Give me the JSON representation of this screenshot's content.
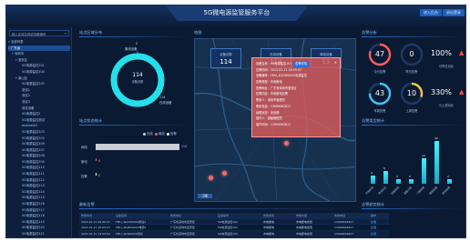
{
  "header": {
    "title": "5G微电源监管服务平台",
    "btn_left": "进入后台",
    "btn_right": "退出登录"
  },
  "sidebar": {
    "search_placeholder": "输入区域名称或设备编号",
    "items": [
      {
        "label": "全部列表",
        "level": 0,
        "caret": "▾"
      },
      {
        "label": "广东省",
        "level": 0,
        "caret": "▾",
        "selected": true
      },
      {
        "label": "深圳市",
        "level": 1,
        "caret": "▾"
      },
      {
        "label": "宝安区",
        "level": 2,
        "caret": "▾"
      },
      {
        "label": "5G电源监控101",
        "level": 3,
        "caret": ""
      },
      {
        "label": "5G电源监控104",
        "level": 3,
        "caret": ""
      },
      {
        "label": "南山区",
        "level": 2,
        "caret": "▾"
      },
      {
        "label": "5G电源监控102",
        "level": 3,
        "caret": ""
      },
      {
        "label": "测试1",
        "level": 3,
        "caret": ""
      },
      {
        "label": "测试2",
        "level": 3,
        "caret": ""
      },
      {
        "label": "测试3",
        "level": 3,
        "caret": ""
      },
      {
        "label": "测试设备",
        "level": 3,
        "caret": ""
      },
      {
        "label": "5G电源监控1",
        "level": 3,
        "caret": ""
      },
      {
        "label": "5G电源监控测试",
        "level": 3,
        "caret": ""
      },
      {
        "label": "meltest01",
        "level": 3,
        "caret": ""
      },
      {
        "label": "5G电源监控103",
        "level": 3,
        "caret": ""
      },
      {
        "label": "5G电源监控105",
        "level": 3,
        "caret": ""
      },
      {
        "label": "5G电源监控106",
        "level": 3,
        "caret": ""
      },
      {
        "label": "5G电源监控107",
        "level": 3,
        "caret": ""
      },
      {
        "label": "5G电源监控108",
        "level": 3,
        "caret": ""
      },
      {
        "label": "5G电源监控109",
        "level": 3,
        "caret": ""
      },
      {
        "label": "5G电源监控110",
        "level": 3,
        "caret": ""
      },
      {
        "label": "5G电源监控111",
        "level": 3,
        "caret": ""
      },
      {
        "label": "5G电源监控112",
        "level": 3,
        "caret": ""
      },
      {
        "label": "5G电源监控113",
        "level": 3,
        "caret": ""
      },
      {
        "label": "5G电源监控114",
        "level": 3,
        "caret": ""
      },
      {
        "label": "5G电源监控115",
        "level": 3,
        "caret": ""
      },
      {
        "label": "5G电源监控116",
        "level": 3,
        "caret": ""
      },
      {
        "label": "5G电源监控117",
        "level": 3,
        "caret": ""
      },
      {
        "label": "5G电源监控118",
        "level": 3,
        "caret": ""
      },
      {
        "label": "5G电源监控119",
        "level": 3,
        "caret": ""
      },
      {
        "label": "5G电源监控120",
        "level": 3,
        "caret": ""
      },
      {
        "label": "5G电源监控121",
        "level": 3,
        "caret": ""
      },
      {
        "label": "5G电源监控122",
        "level": 3,
        "caret": ""
      }
    ]
  },
  "device_distribution": {
    "title": "站点区域分布",
    "top_label": "离线设备",
    "top_value": "0",
    "center_value": "114",
    "center_label": "设备总数",
    "bottom_value": "114",
    "bottom_label": "在线设备"
  },
  "status_stats": {
    "title": "站点状态统计",
    "legend": [
      {
        "label": "在线",
        "color": "#c9ced6"
      },
      {
        "label": "离线",
        "color": "#ff5a5a"
      },
      {
        "label": "告警",
        "color": "#ffffff"
      }
    ]
  },
  "chart_data": {
    "type": "bar",
    "orientation": "horizontal",
    "categories": [
      "网络",
      "断电",
      "告警"
    ],
    "values": [
      114,
      0,
      0
    ],
    "xlim": [
      0,
      114
    ]
  },
  "alarm_table": {
    "title": "最新告警",
    "headers": [
      "告警时间",
      "设备名称",
      "告警地址",
      "设备编号",
      "告警类型",
      "告警内容",
      "告警电话",
      "操作"
    ],
    "rows": [
      [
        "2023-01-11 09:46:07",
        "FMU_4G2305009测试1",
        "广东省深圳市宝安区",
        "5G电源监控102",
        "市电断电",
        "市电断电告警",
        "13999562827",
        "处理"
      ],
      [
        "2023-01-11 16:09:07",
        "FMU_4G4E00023电源1",
        "广东省深圳市宝安区",
        "5G电源监控101",
        "市电断电",
        "市电断电告警",
        "13999562827",
        "处理"
      ],
      [
        "2023-01-11 14:09:02",
        "FMU_4G360020测试",
        "广东省深圳市宝安区",
        "5G电源监控103",
        "市电断电",
        "市电断电告警",
        "13999562827",
        "处理"
      ],
      [
        "2023-01-11 14:05:05",
        "FMU_4G4E00023测试",
        "广东省深圳市南山区",
        "5G电源监控104",
        "市电断电",
        "市电断电告警",
        "13999562827",
        "处理"
      ]
    ]
  },
  "map": {
    "title": "地图",
    "cards": [
      {
        "label": "设备总数",
        "value": "114"
      },
      {
        "label": "在线设备",
        "value": "114"
      },
      {
        "label": "离线设备",
        "value": "13"
      }
    ],
    "popup": {
      "rows": [
        "设备名称：5G电源监控101",
        "告警时间：2023-01-11 16:09:07",
        "设备编号：FMU_4G2300042电源监控",
        "告警类型：市电断电",
        "告警地址：广东省深圳市宝安区",
        "告警内容：市电断电告警",
        "联系人：深圳市管理员",
        "联系电话：13999562827",
        "处理状态：未处理",
        "操作人：超级管理员",
        "操作时间：13999562827"
      ],
      "tag": "告警详情",
      "close": "×"
    },
    "control_label": "卫星"
  },
  "alarm_analysis": {
    "title": "告警分析",
    "gauges": [
      {
        "value": "47",
        "label": "今日告警",
        "color": "#ff5d5d",
        "fraction": 0.8
      },
      {
        "value": "0",
        "label": "昨日告警",
        "color": "#ff5d5d",
        "fraction": 0.0
      },
      {
        "value": "43",
        "label": "本周告警",
        "color": "#3ec7f5",
        "fraction": 0.75
      },
      {
        "value": "10",
        "label": "上周告警",
        "color": "#f5c842",
        "fraction": 0.3
      }
    ],
    "pct_top": "100%",
    "pct_top_label": "与昨日对比",
    "pct_bottom": "330%",
    "pct_bottom_label": "与上周对比"
  },
  "alarm_types": {
    "title": "告警类型统计",
    "bars": [
      {
        "label": "市电断电",
        "value": 4
      },
      {
        "label": "电池低压",
        "value": 6
      },
      {
        "label": "设备离线",
        "value": 2
      },
      {
        "label": "温度过高",
        "value": 2
      },
      {
        "label": "门磁告警",
        "value": 12
      },
      {
        "label": "烟感告警",
        "value": 20
      },
      {
        "label": "其他告警",
        "value": 2
      }
    ],
    "max": 22
  },
  "bottom_right": {
    "title": "告警趋势统计"
  }
}
